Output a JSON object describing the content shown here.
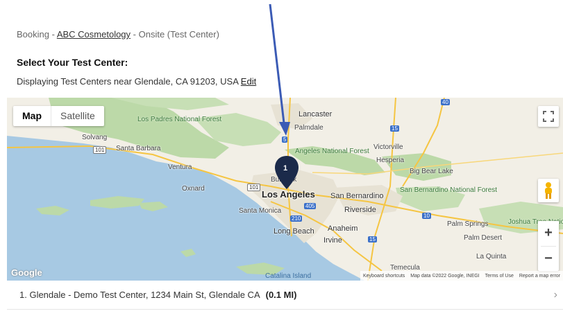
{
  "breadcrumb": {
    "prefix": "Booking - ",
    "link": "ABC Cosmetology",
    "suffix": " - Onsite (Test Center)"
  },
  "section_title": "Select Your Test Center:",
  "location": {
    "text": "Displaying Test Centers near Glendale, CA 91203, USA",
    "edit_label": "Edit"
  },
  "map": {
    "map_button": "Map",
    "satellite_button": "Satellite",
    "google_logo": "Google",
    "marker_number": "1",
    "labels": {
      "lancaster": "Lancaster",
      "palmdale": "Palmdale",
      "victorville": "Victorville",
      "hesperia": "Hesperia",
      "big_bear_lake": "Big Bear Lake",
      "los_padres": "Los Padres National Forest",
      "solvang": "Solvang",
      "santa_barbara": "Santa Barbara",
      "ventura": "Ventura",
      "oxnard": "Oxnard",
      "angeles_nf": "Angeles National Forest",
      "burbank": "Burbank",
      "los_angeles": "Los Angeles",
      "santa_monica": "Santa Monica",
      "san_bernardino": "San Bernardino",
      "riverside": "Riverside",
      "san_bernardino_nf": "San Bernardino National Forest",
      "long_beach": "Long Beach",
      "anaheim": "Anaheim",
      "irvine": "Irvine",
      "palm_springs": "Palm Springs",
      "palm_desert": "Palm Desert",
      "joshua_tree": "Joshua Tree National",
      "la_quinta": "La Quinta",
      "temecula": "Temecula",
      "catalina": "Catalina Island"
    },
    "shields": {
      "i5_top": "5",
      "i15": "15",
      "hw40": "40",
      "hw101_left": "101",
      "hw101_mid": "101",
      "i405": "405",
      "i210": "210",
      "i15_lower": "15",
      "i10": "10"
    },
    "attribution": {
      "shortcuts": "Keyboard shortcuts",
      "data": "Map data ©2022 Google, INEGI",
      "terms": "Terms of Use",
      "report": "Report a map error"
    },
    "colors": {
      "water": "#a7c9e3",
      "land": "#f2efe6",
      "forest": "#bcd9a8",
      "urban": "#e7e2d4",
      "marker": "#1b2a4a"
    }
  },
  "results": [
    {
      "label": "1. Glendale - Demo Test Center, 1234 Main St, Glendale CA",
      "distance": "(0.1 MI)"
    }
  ]
}
